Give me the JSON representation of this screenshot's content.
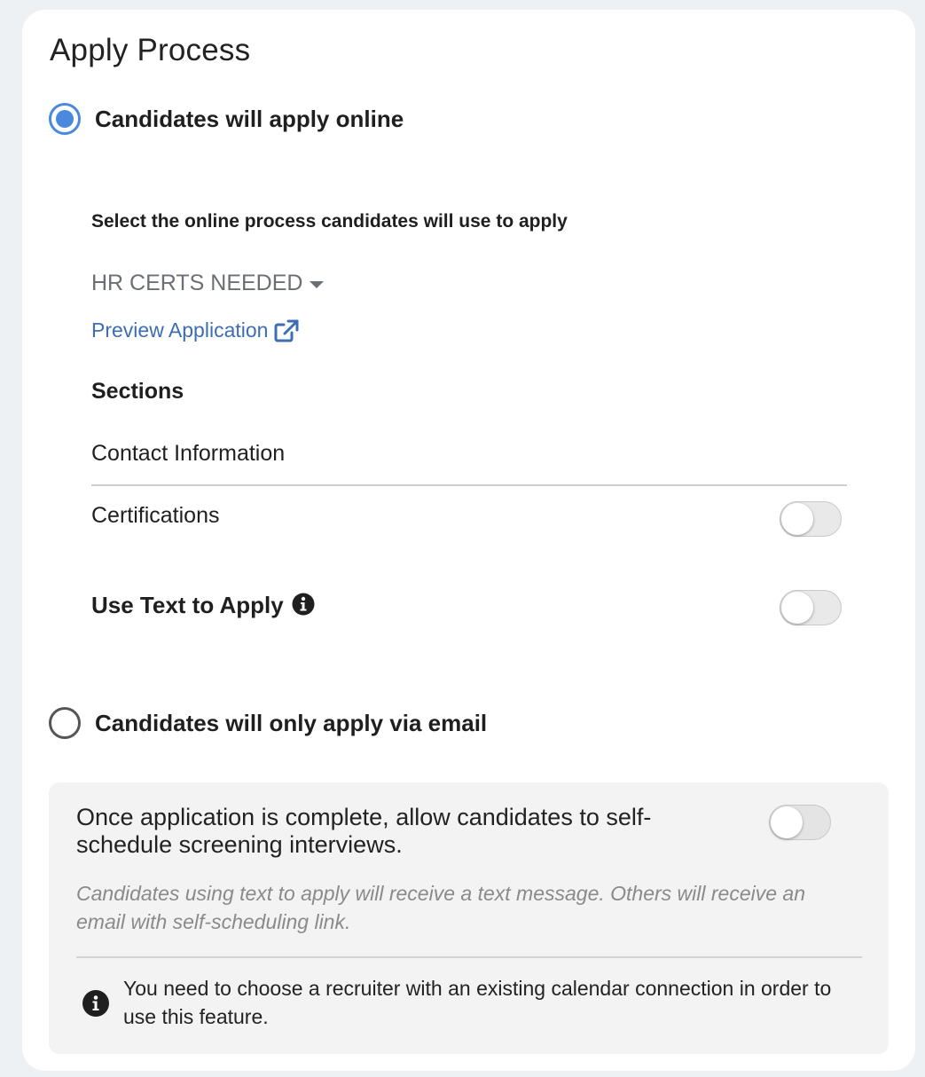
{
  "page": {
    "title": "Apply Process"
  },
  "apply_options": {
    "online_label": "Candidates will apply online",
    "online_selected": true,
    "email_label": "Candidates will only apply via email",
    "email_selected": false
  },
  "online": {
    "select_heading": "Select the online process candidates will use to apply",
    "process_value": "HR CERTS NEEDED",
    "preview_link": "Preview Application",
    "sections_heading": "Sections",
    "sections": [
      {
        "label": "Contact Information",
        "has_toggle": false
      },
      {
        "label": "Certifications",
        "has_toggle": true,
        "enabled": false
      }
    ],
    "text_to_apply_label": "Use Text to Apply",
    "text_to_apply_enabled": false
  },
  "self_schedule": {
    "description": "Once application is complete, allow candidates to self-schedule screening interviews.",
    "enabled": false,
    "note": "Candidates using text to apply will receive a text message. Others will receive an email with self-scheduling link.",
    "info": "You need to choose a recruiter with an existing calendar connection in order to use this feature."
  },
  "colors": {
    "accent": "#4a89dc",
    "link": "#3d6db5",
    "panel_bg": "#f3f3f3",
    "page_bg": "#eef1f4"
  },
  "icons": {
    "external_link": "external-link-icon",
    "info": "info-icon"
  }
}
